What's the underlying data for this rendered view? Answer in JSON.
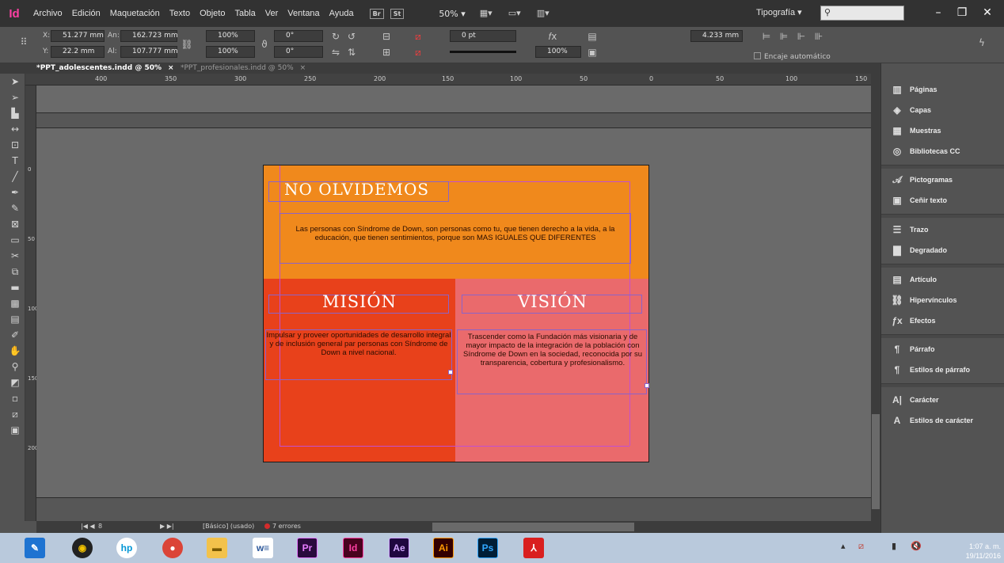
{
  "menubar": {
    "app_logo": "Id",
    "items": [
      "Archivo",
      "Edición",
      "Maquetación",
      "Texto",
      "Objeto",
      "Tabla",
      "Ver",
      "Ventana",
      "Ayuda"
    ],
    "bridge_label": "Br",
    "stock_label": "St",
    "zoom": "50% ▾",
    "workspace": "Tipografía ▾",
    "search_placeholder": ""
  },
  "control_panel": {
    "x_label": "X:",
    "x_value": "51.277 mm",
    "y_label": "Y:",
    "y_value": "22.2 mm",
    "w_label": "An:",
    "w_value": "162.723 mm",
    "h_label": "Al:",
    "h_value": "107.777 mm",
    "scale_x": "100%",
    "scale_y": "100%",
    "rotation": "0°",
    "shear": "0°",
    "stroke_weight": "0 pt",
    "opacity": "100%",
    "gutter": "4.233 mm",
    "encaje": "Encaje automático"
  },
  "tabs": [
    {
      "label": "*PPT_adolescentes.indd @ 50%",
      "close": "×"
    },
    {
      "label": "*PPT_profesionales.indd @ 50%",
      "close": "×"
    }
  ],
  "ruler_h": [
    "400",
    "350",
    "300",
    "250",
    "200",
    "150",
    "100",
    "50",
    "0",
    "50",
    "100",
    "150"
  ],
  "ruler_v": [
    "0",
    "50",
    "100",
    "150",
    "200"
  ],
  "document": {
    "top_title": "NO OLVIDEMOS",
    "top_body": "Las personas con Síndrome de Down, son personas como tu, que tienen derecho a la vida, a la educación, que tienen sentimientos, porque son MAS IGUALES QUE DIFERENTES",
    "mision_title": "MISIÓN",
    "mision_body": "Impulsar y proveer oportunidades de desarrollo integral y de inclusión general par personas con Síndrome de Down a nivel nacional.",
    "vision_title": "VISIÓN",
    "vision_body": "Trascender como la Fundación más visionaria y de mayor impacto de la integración de la población con Síndrome de Down en la sociedad, reconocida por su transparencia, cobertura y profesionalismo."
  },
  "status_bar": {
    "page": "8",
    "style": "[Básico] (usado)",
    "errors": "7 errores"
  },
  "right_panels": [
    {
      "label": "Páginas",
      "icon": "pages-icon"
    },
    {
      "label": "Capas",
      "icon": "layers-icon"
    },
    {
      "label": "Muestras",
      "icon": "swatches-icon"
    },
    {
      "label": "Bibliotecas CC",
      "icon": "cc-libraries-icon"
    },
    {
      "label": "Pictogramas",
      "icon": "glyphs-icon"
    },
    {
      "label": "Ceñir texto",
      "icon": "text-wrap-icon"
    },
    {
      "label": "Trazo",
      "icon": "stroke-icon"
    },
    {
      "label": "Degradado",
      "icon": "gradient-icon"
    },
    {
      "label": "Artículo",
      "icon": "articles-icon"
    },
    {
      "label": "Hipervínculos",
      "icon": "hyperlinks-icon"
    },
    {
      "label": "Efectos",
      "icon": "effects-icon"
    },
    {
      "label": "Párrafo",
      "icon": "paragraph-icon"
    },
    {
      "label": "Estilos de párrafo",
      "icon": "paragraph-styles-icon"
    },
    {
      "label": "Carácter",
      "icon": "character-icon"
    },
    {
      "label": "Estilos de carácter",
      "icon": "character-styles-icon"
    }
  ],
  "taskbar": {
    "apps": [
      "w≡",
      "Pr",
      "Id",
      "Ae",
      "Ai",
      "Ps"
    ],
    "time": "1:07 a. m.",
    "date": "19/11/2016"
  },
  "colors": {
    "indesign_pink": "#ff3fa4",
    "top_panel": "#f0891c",
    "mision_panel": "#e8411b",
    "vision_panel": "#ea6a6c",
    "frame": "#8b63c9",
    "guide": "#c24fd1"
  }
}
